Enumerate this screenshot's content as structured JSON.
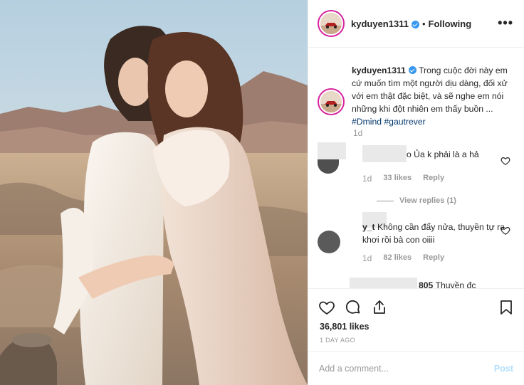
{
  "header": {
    "username": "kyduyen1311",
    "separator": "•",
    "follow_status": "Following",
    "more_label": "•••"
  },
  "caption": {
    "username": "kyduyen1311",
    "text": "Trong cuộc đời này em cứ muốn tìm một người dịu dàng, đối xử với em thật đặc biệt, và sẽ nghe em nói những khi đột nhiên em thấy buồn ...",
    "hashtag1": "#Dmind",
    "hashtag2": "#gautrever",
    "time": "1d"
  },
  "comments": [
    {
      "username": "",
      "text": "o Ủa k phải là a hả",
      "time": "1d",
      "likes": "33 likes",
      "reply": "Reply"
    },
    {
      "username": "y_t",
      "text": "Không cần đẩy nửa, thuyền tự ra khơi rồi bà con oiiii",
      "time": "1d",
      "likes": "82 likes",
      "reply": "Reply"
    },
    {
      "username": "805",
      "text": "Thuyền đc"
    }
  ],
  "view_replies": "View replies (1)",
  "actions": {
    "likes": "36,801 likes",
    "post_time": "1 DAY AGO"
  },
  "add_comment": {
    "placeholder": "Add a comment...",
    "post_label": "Post"
  },
  "icons": {
    "like": "heart-icon",
    "comment": "comment-icon",
    "share": "share-icon",
    "save": "bookmark-icon",
    "verified": "verified-badge-icon"
  },
  "colors": {
    "verified": "#3897f0",
    "hashtag": "#003569",
    "post_disabled": "#b2dffc",
    "muted": "#999999"
  }
}
